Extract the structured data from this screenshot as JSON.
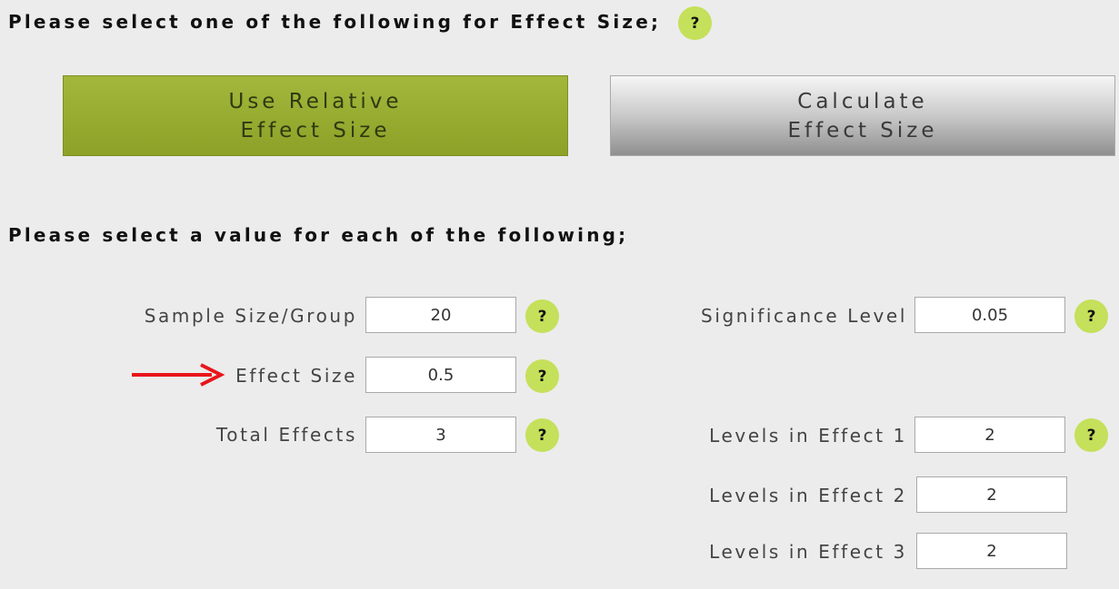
{
  "headings": {
    "effect_size_prompt": "Please select one of the following for Effect Size;",
    "values_prompt": "Please select a value for each of the following;"
  },
  "buttons": {
    "relative": [
      "Use Relative",
      "Effect Size"
    ],
    "calculate": [
      "Calculate",
      "Effect Size"
    ]
  },
  "help_label": "?",
  "fields": {
    "sample_size": {
      "label": "Sample Size/Group",
      "value": "20"
    },
    "effect_size": {
      "label": "Effect Size",
      "value": "0.5"
    },
    "total_effects": {
      "label": "Total Effects",
      "value": "3"
    },
    "significance": {
      "label": "Significance Level",
      "value": "0.05"
    },
    "levels_1": {
      "label": "Levels in Effect 1",
      "value": "2"
    },
    "levels_2": {
      "label": "Levels in Effect 2",
      "value": "2"
    },
    "levels_3": {
      "label": "Levels in Effect 3",
      "value": "2"
    }
  },
  "colors": {
    "relative_button": "#9caf34",
    "help_badge": "#c5e05a",
    "arrow": "#e8161b",
    "background": "#ececec"
  }
}
